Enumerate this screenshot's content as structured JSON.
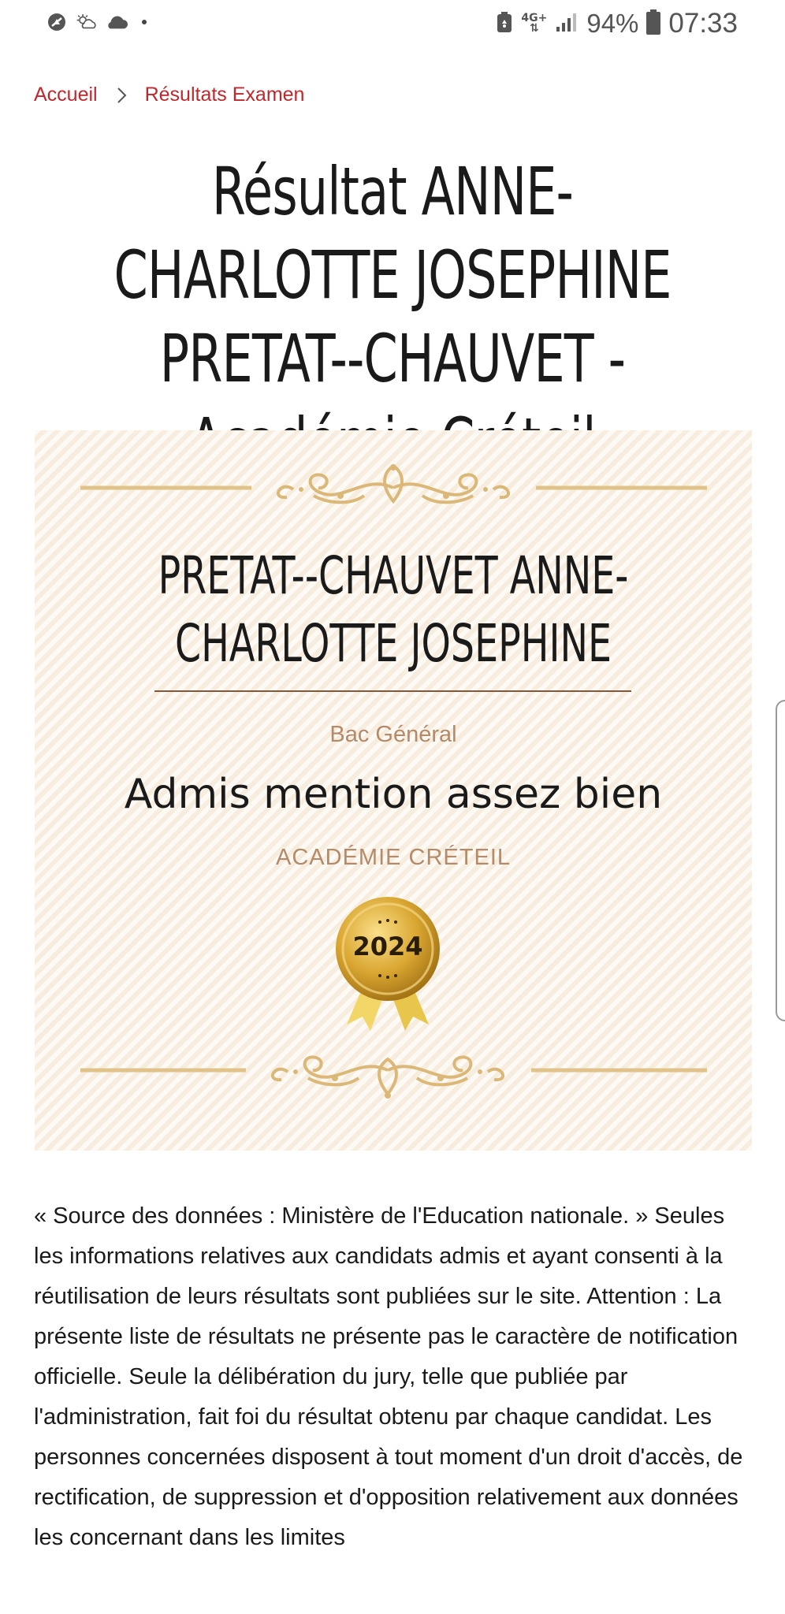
{
  "status_bar": {
    "battery_percent": "94%",
    "time": "07:33",
    "network_label": "4G+",
    "icons": [
      "no-disturb-icon",
      "weather-sun-cloud-icon",
      "cloud-icon",
      "notification-dot-icon",
      "battery-saver-icon",
      "network-4g-icon",
      "signal-icon",
      "battery-icon"
    ]
  },
  "breadcrumb": {
    "home": "Accueil",
    "current": "Résultats Examen"
  },
  "page": {
    "title": "Résultat ANNE-CHARLOTTE JOSEPHINE PRETAT--CHAUVET - Académie Créteil"
  },
  "certificate": {
    "candidate_name": "PRETAT--CHAUVET ANNE-CHARLOTTE JOSEPHINE",
    "exam": "Bac Général",
    "result": "Admis mention assez bien",
    "academy": "ACADÉMIE CRÉTEIL",
    "year": "2024",
    "colors": {
      "background": "#fbf3e8",
      "gold": "#e3c38a",
      "accent_text": "#b48a69"
    }
  },
  "disclaimer": {
    "text": "« Source des données : Ministère de l'Education nationale. » Seules les informations relatives aux candidats admis et ayant consenti à la réutilisation de leurs résultats sont publiées sur le site. Attention : La présente liste de résultats ne présente pas le caractère de notification officielle. Seule la délibération du jury, telle que publiée par l'administration, fait foi du résultat obtenu par chaque candidat. Les personnes concernées disposent à tout moment d'un droit d'accès, de rectification, de suppression et d'opposition relativement aux données les concernant dans les limites"
  },
  "theme": {
    "link_color": "#c0272d"
  }
}
